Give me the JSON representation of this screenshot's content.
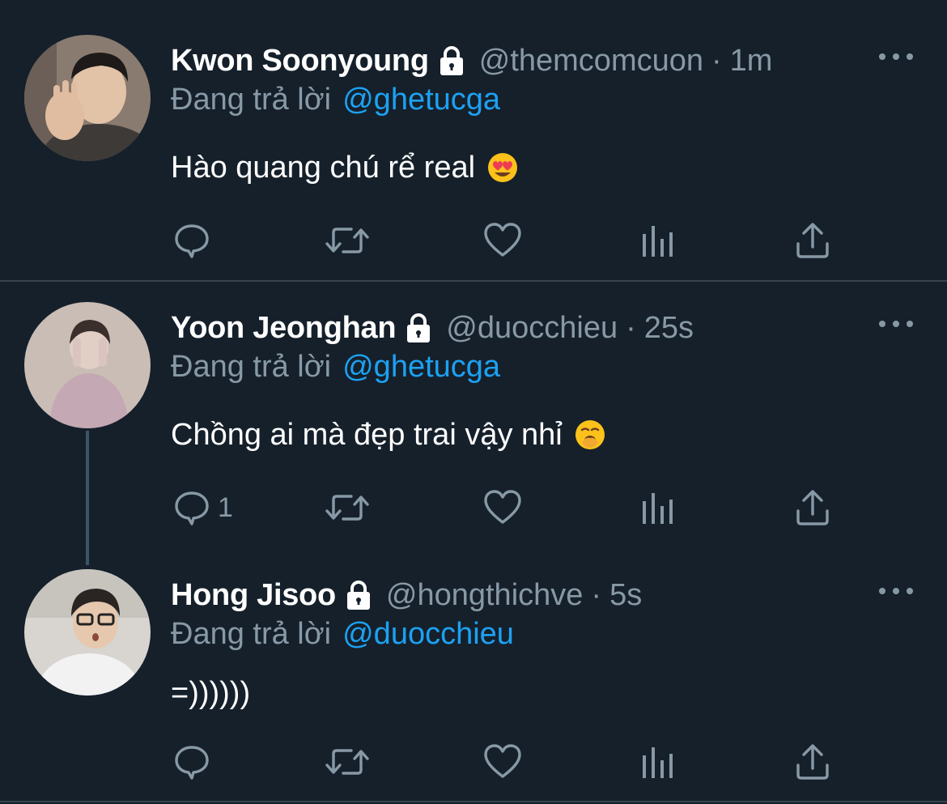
{
  "tweets": [
    {
      "name": "Kwon Soonyoung",
      "handle": "@themcomcuon",
      "separator": "·",
      "time": "1m",
      "reply_prefix": "Đang trả lời",
      "reply_to": "@ghetucga",
      "text": "Hào quang chú rể real",
      "emoji": "heart-eyes-emoji",
      "reply_count": "",
      "icons": [
        "reply-icon",
        "retweet-icon",
        "like-icon",
        "analytics-icon",
        "share-icon"
      ]
    },
    {
      "name": "Yoon Jeonghan",
      "handle": "@duocchieu",
      "separator": "·",
      "time": "25s",
      "reply_prefix": "Đang trả lời",
      "reply_to": "@ghetucga",
      "text": "Chồng ai mà đẹp trai vậy nhỉ",
      "emoji": "yawning-face-emoji",
      "reply_count": "1",
      "icons": [
        "reply-icon",
        "retweet-icon",
        "like-icon",
        "analytics-icon",
        "share-icon"
      ]
    },
    {
      "name": "Hong Jisoo",
      "handle": "@hongthichve",
      "separator": "·",
      "time": "5s",
      "reply_prefix": "Đang trả lời",
      "reply_to": "@duocchieu",
      "text": "=))))))",
      "emoji": "",
      "reply_count": "",
      "icons": [
        "reply-icon",
        "retweet-icon",
        "like-icon",
        "analytics-icon",
        "share-icon"
      ]
    }
  ],
  "colors": {
    "background": "#15202b",
    "divider": "#38444d",
    "name": "#ffffff",
    "secondary_text": "#8899a6",
    "link": "#1da1f2"
  }
}
